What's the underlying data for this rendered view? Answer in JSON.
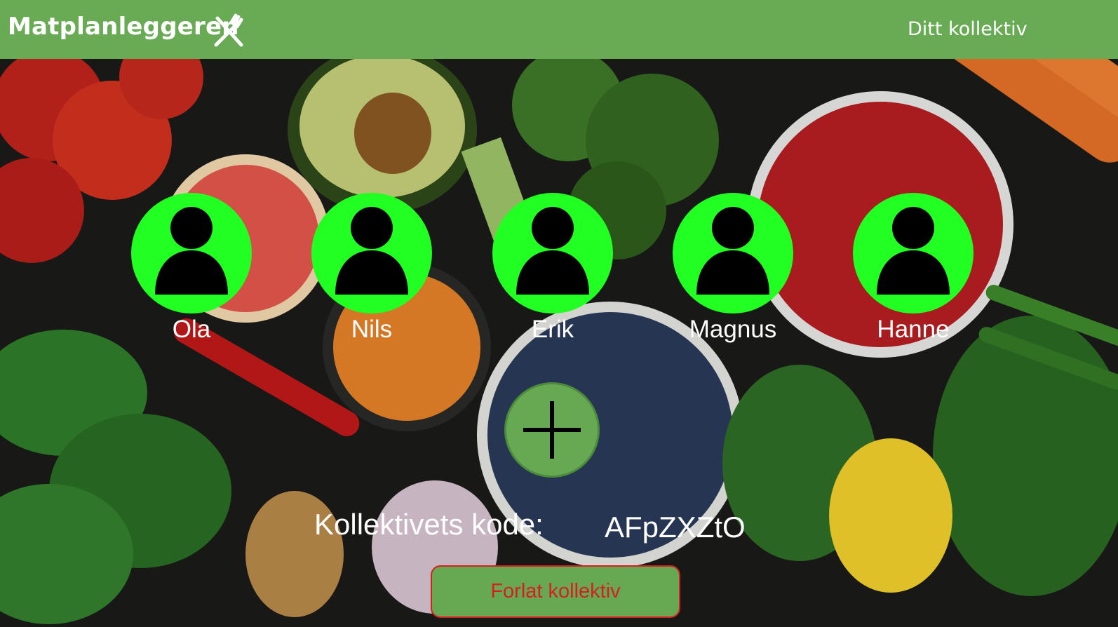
{
  "header": {
    "app_title": "Matplanleggeren",
    "logo_icon": "fork-knife-crossed-icon",
    "nav_link": "Ditt kollektiv",
    "background_color": "#69aa55"
  },
  "members": [
    {
      "name": "Ola"
    },
    {
      "name": "Nils"
    },
    {
      "name": "Erik"
    },
    {
      "name": "Magnus"
    },
    {
      "name": "Hanne"
    }
  ],
  "avatar": {
    "icon": "user-icon",
    "color": "#22ff22"
  },
  "add_button": {
    "icon": "plus-icon",
    "color": "#67a853"
  },
  "collective_code": {
    "label": "Kollektivets kode:",
    "value": "AFpZXZtO"
  },
  "leave_button": {
    "label": "Forlat kollektiv",
    "text_color": "#d42020"
  }
}
